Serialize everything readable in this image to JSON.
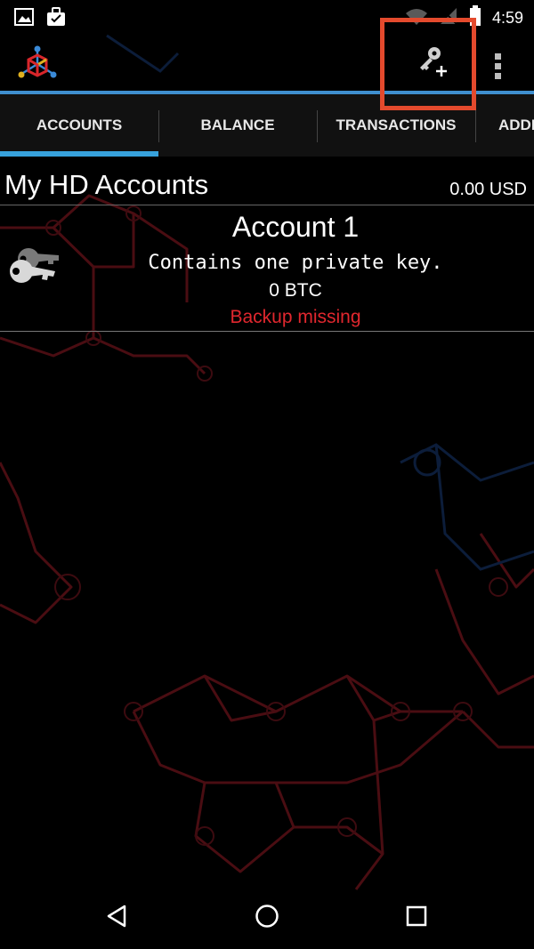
{
  "status_bar": {
    "time": "4:59",
    "icons": [
      "gallery-icon",
      "briefcase-icon",
      "wifi-icon",
      "no-sim-icon",
      "battery-icon"
    ]
  },
  "app_bar": {
    "logo": "mycelium-logo",
    "actions": [
      "add-key-icon",
      "overflow-menu-icon"
    ],
    "accent_color": "#3f8fcf",
    "highlight_color": "#e44a2d"
  },
  "tabs": [
    {
      "label": "ACCOUNTS",
      "selected": true
    },
    {
      "label": "BALANCE",
      "selected": false
    },
    {
      "label": "TRANSACTIONS",
      "selected": false
    },
    {
      "label": "ADDRESSES",
      "selected": false
    }
  ],
  "section": {
    "title": "My HD Accounts",
    "balance": "0.00 USD"
  },
  "account": {
    "name": "Account 1",
    "description": "Contains one private key.",
    "balance": "0 BTC",
    "warning": "Backup missing",
    "warning_color": "#e0272e"
  },
  "nav_bar": {
    "buttons": [
      "back-icon",
      "home-icon",
      "recents-icon"
    ]
  }
}
